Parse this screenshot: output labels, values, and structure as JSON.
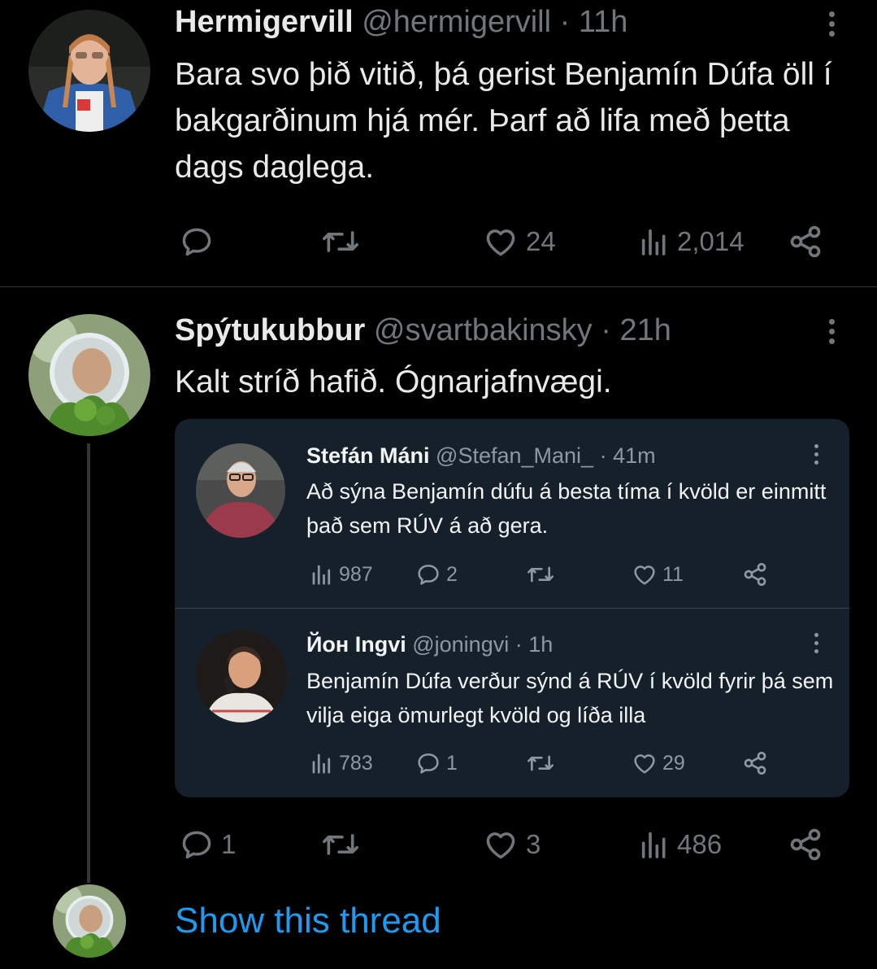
{
  "tweets": [
    {
      "name": "Hermigervill",
      "handle": "@hermigervill",
      "separator": "·",
      "time": "11h",
      "text": "Bara svo þið vitið, þá gerist Benjamín Dúfa öll í bakgarðinum hjá mér. Þarf að lifa með þetta dags daglega.",
      "likes": "24",
      "views": "2,014"
    },
    {
      "name": "Spýtukubbur",
      "handle": "@svartbakinsky",
      "separator": "·",
      "time": "21h",
      "text": "Kalt stríð hafið. Ógnarjafnvægi.",
      "replies": "1",
      "likes": "3",
      "views": "486"
    }
  ],
  "quoted": [
    {
      "name": "Stefán Máni",
      "handle": "@Stefan_Mani_",
      "separator": "·",
      "time": "41m",
      "text": "Að sýna Benjamín dúfu á besta tíma í kvöld er einmitt það sem RÚV á að gera.",
      "views": "987",
      "replies": "2",
      "likes": "11"
    },
    {
      "name": "Йон Ingvi",
      "handle": "@joningvi",
      "separator": "·",
      "time": "1h",
      "text": "Benjamín Dúfa verður sýnd á RÚV í kvöld fyrir þá sem vilja eiga ömurlegt kvöld og líða illa",
      "views": "783",
      "replies": "1",
      "likes": "29"
    }
  ],
  "show_thread": "Show this thread",
  "colors": {
    "link": "#1d9bf0",
    "muted": "#71767b",
    "quote_bg": "#15202b"
  },
  "icons": [
    "reply-icon",
    "retweet-icon",
    "like-icon",
    "views-icon",
    "share-icon",
    "more-icon"
  ]
}
